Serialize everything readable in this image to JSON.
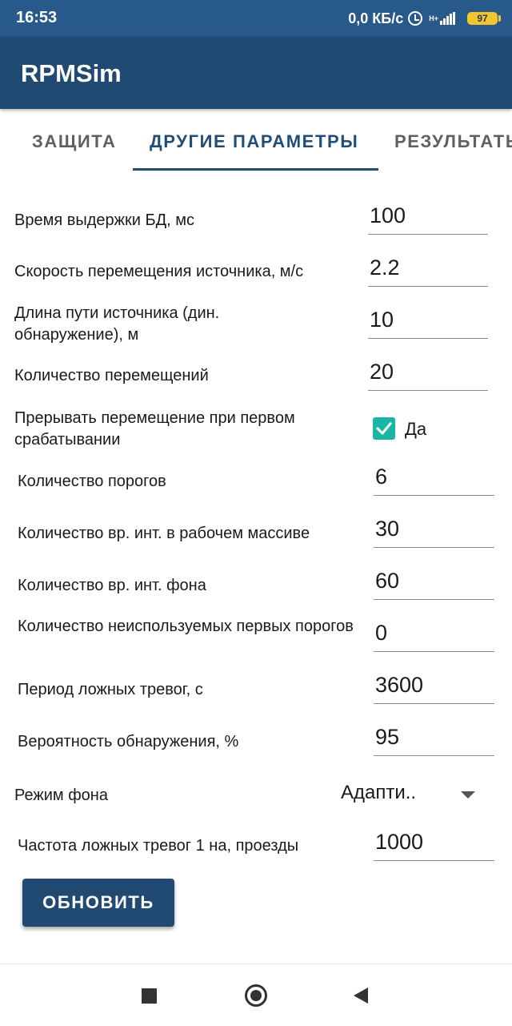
{
  "status_bar": {
    "time": "16:53",
    "speed": "0,0 КБ/с",
    "network": "H+",
    "battery": "97"
  },
  "app_bar": {
    "title": "RPMSim"
  },
  "tabs": [
    {
      "label": "ЗАЩИТА",
      "active": false
    },
    {
      "label": "ДРУГИЕ ПАРАМЕТРЫ",
      "active": true
    },
    {
      "label": "РЕЗУЛЬТАТЫ",
      "active": false
    }
  ],
  "form": {
    "detector_hold_time": {
      "label": "Время выдержки БД, мс",
      "value": "100"
    },
    "source_speed": {
      "label": "Скорость перемещения источника, м/с",
      "value": "2.2"
    },
    "source_path_length": {
      "label": "Длина пути источника (дин. обнаружение), м",
      "value": "10"
    },
    "moves_count": {
      "label": "Количество перемещений",
      "value": "20"
    },
    "interrupt_on_first": {
      "label": "Прерывать перемещение при первом срабатывании",
      "checked": true,
      "checkbox_label": "Да"
    },
    "thresholds_count": {
      "label": "Количество порогов",
      "value": "6"
    },
    "work_array_intervals": {
      "label": "Количество вр. инт. в рабочем массиве",
      "value": "30"
    },
    "background_intervals": {
      "label": "Количество вр. инт. фона",
      "value": "60"
    },
    "unused_first_thresholds": {
      "label": "Количество неиспользуемых первых порогов",
      "value": "0"
    },
    "false_alarm_period": {
      "label": "Период ложных тревог, с",
      "value": "3600"
    },
    "detection_probability": {
      "label": "Вероятность обнаружения, %",
      "value": "95"
    },
    "background_mode": {
      "label": "Режим фона",
      "selected": "Адапти.."
    },
    "false_alarm_rate": {
      "label": "Частота ложных тревог 1 на, проезды",
      "value": "1000"
    }
  },
  "update_button": {
    "label": "ОБНОВИТЬ"
  },
  "colors": {
    "status_bar": "#275a8a",
    "app_bar": "#204a72",
    "accent": "#1f4e79",
    "checkbox": "#19b6a6",
    "battery": "#f3c531"
  }
}
